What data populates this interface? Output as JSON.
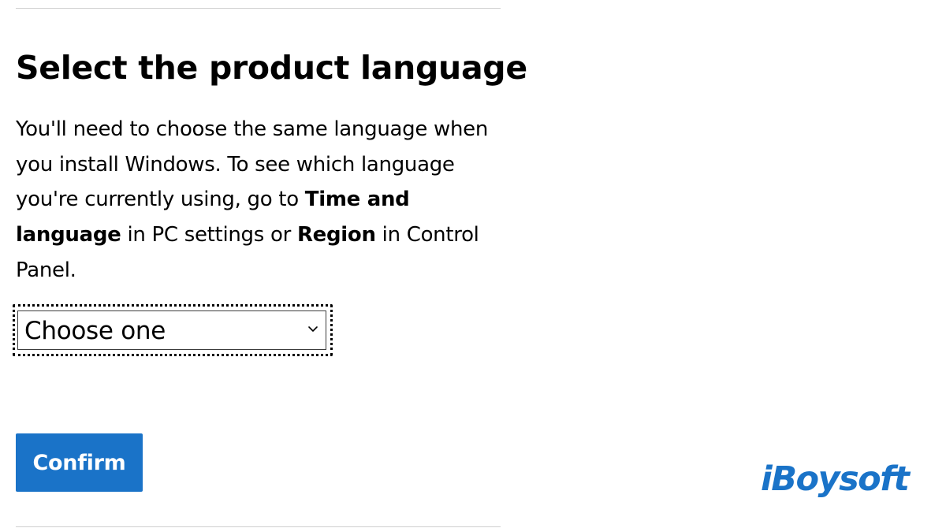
{
  "heading": "Select the product language",
  "description": {
    "part1": "You'll need to choose the same language when you install Windows. To see which language you're currently using, go to ",
    "bold1": "Time and language",
    "part2": " in PC settings or ",
    "bold2": "Region",
    "part3": " in Control Panel."
  },
  "language_select": {
    "value": "Choose one",
    "icon": "chevron-down-icon"
  },
  "confirm_button": {
    "label": "Confirm",
    "color": "#1a73c8"
  },
  "watermark": {
    "text": "iBoysoft",
    "color": "#1a73c8"
  }
}
